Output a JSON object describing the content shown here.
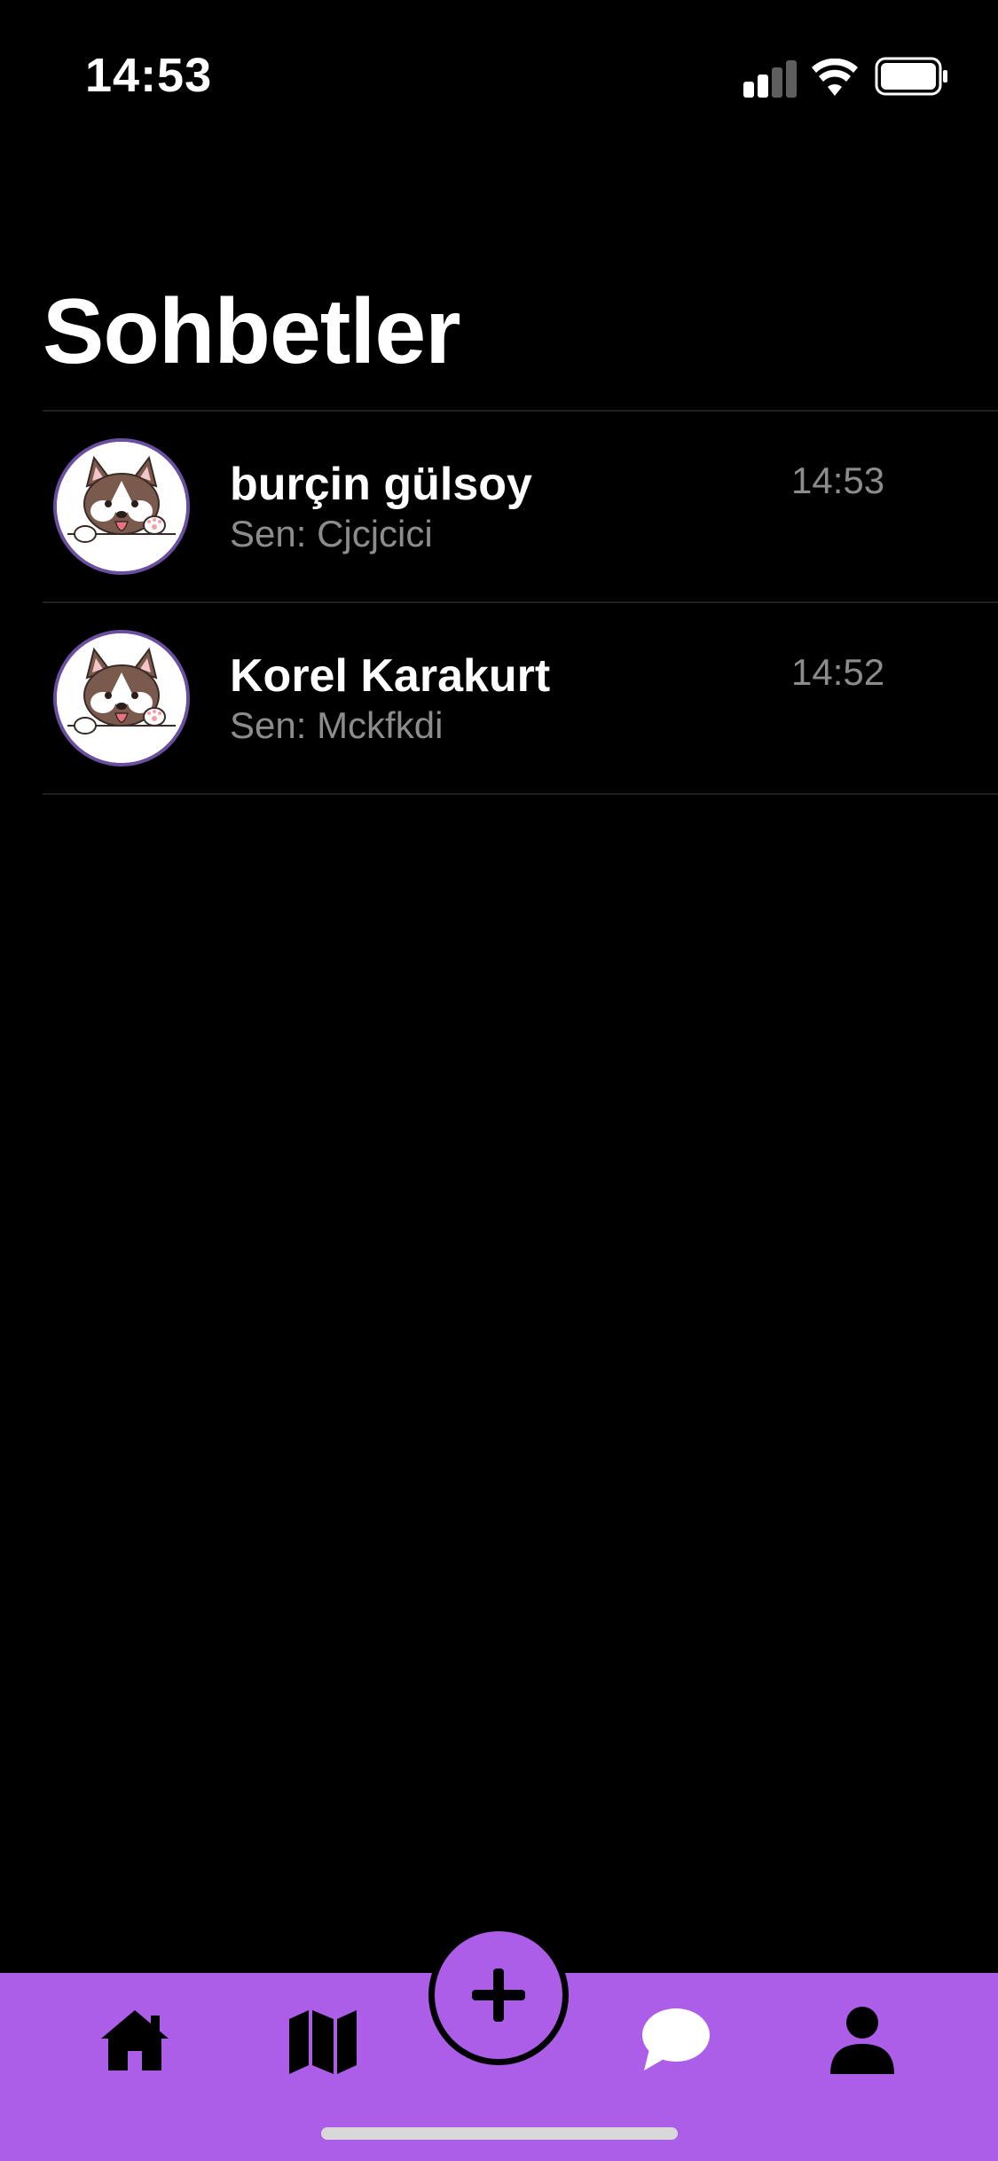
{
  "status_bar": {
    "time": "14:53"
  },
  "page": {
    "title": "Sohbetler"
  },
  "chats": [
    {
      "name": "burçin gülsoy",
      "preview": "Sen: Cjcjcici",
      "time": "14:53",
      "avatar": "husky-dog-avatar"
    },
    {
      "name": "Korel Karakurt",
      "preview": "Sen: Mckfkdi",
      "time": "14:52",
      "avatar": "husky-dog-avatar"
    }
  ],
  "tab_bar": {
    "items": [
      {
        "icon": "home-icon"
      },
      {
        "icon": "map-icon"
      },
      {
        "icon": "plus-icon"
      },
      {
        "icon": "chat-bubble-icon"
      },
      {
        "icon": "person-icon"
      }
    ]
  },
  "colors": {
    "background": "#000000",
    "accent": "#ad5ee8",
    "avatar_ring": "#6a4fa0",
    "secondary_text": "#8c8c8c"
  }
}
